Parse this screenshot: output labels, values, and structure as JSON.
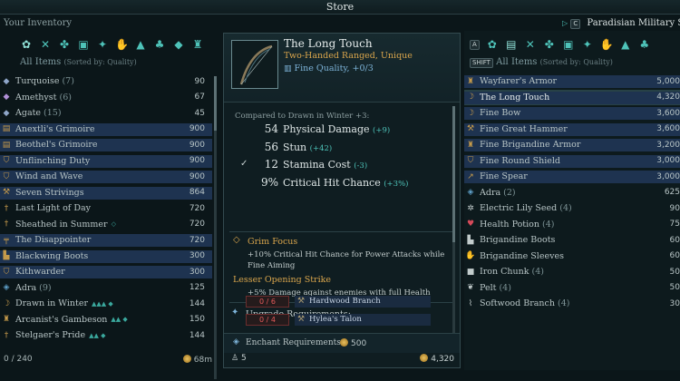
{
  "header": {
    "title": "Store"
  },
  "inventory": {
    "label": "Your Inventory",
    "filter_label": "All Items",
    "sorted_label": "(Sorted by: Quality)",
    "items": [
      {
        "name": "Turquoise",
        "count": "(7)",
        "value": "90",
        "icon": "gem-icon",
        "color": "#8fa6c9",
        "bar": null,
        "pips": ""
      },
      {
        "name": "Amethyst",
        "count": "(6)",
        "value": "67",
        "icon": "gem-icon",
        "color": "#b08fd6",
        "bar": null,
        "pips": ""
      },
      {
        "name": "Agate",
        "count": "(15)",
        "value": "45",
        "icon": "gem-icon",
        "color": "#8fa6c9",
        "bar": null,
        "pips": ""
      },
      {
        "name": "Anextli's Grimoire",
        "count": "",
        "value": "900",
        "icon": "book-icon",
        "color": "#c59a4b",
        "bar": "#1e3350",
        "pips": ""
      },
      {
        "name": "Beothel's Grimoire",
        "count": "",
        "value": "900",
        "icon": "book-icon",
        "color": "#c59a4b",
        "bar": "#1e3350",
        "pips": ""
      },
      {
        "name": "Unflinching Duty",
        "count": "",
        "value": "900",
        "icon": "shield-icon",
        "color": "#c59a4b",
        "bar": "#1e3350",
        "pips": ""
      },
      {
        "name": "Wind and Wave",
        "count": "",
        "value": "900",
        "icon": "shield-icon",
        "color": "#c59a4b",
        "bar": "#1e3350",
        "pips": ""
      },
      {
        "name": "Seven Strivings",
        "count": "",
        "value": "864",
        "icon": "axe-icon",
        "color": "#c59a4b",
        "bar": "#1e3350",
        "pips": ""
      },
      {
        "name": "Last Light of Day",
        "count": "",
        "value": "720",
        "icon": "sword-icon",
        "color": "#c59a4b",
        "bar": null,
        "pips": ""
      },
      {
        "name": "Sheathed in Summer",
        "count": "",
        "value": "720",
        "icon": "sword-icon",
        "color": "#c59a4b",
        "bar": null,
        "pips": "◇"
      },
      {
        "name": "The Disappointer",
        "count": "",
        "value": "720",
        "icon": "gun-icon",
        "color": "#c59a4b",
        "bar": "#1e3350",
        "pips": ""
      },
      {
        "name": "Blackwing Boots",
        "count": "",
        "value": "300",
        "icon": "boots-icon",
        "color": "#c59a4b",
        "bar": "#1e3350",
        "pips": ""
      },
      {
        "name": "Kithwarder",
        "count": "",
        "value": "300",
        "icon": "shield-icon",
        "color": "#c59a4b",
        "bar": "#1e3350",
        "pips": ""
      },
      {
        "name": "Adra",
        "count": "(9)",
        "value": "125",
        "icon": "adra-icon",
        "color": "#5fa0c9",
        "bar": null,
        "pips": ""
      },
      {
        "name": "Drawn in Winter",
        "count": "",
        "value": "144",
        "icon": "bow-icon",
        "color": "#c59a4b",
        "bar": null,
        "pips": "▲▲▲ ◆"
      },
      {
        "name": "Arcanist's Gambeson",
        "count": "",
        "value": "150",
        "icon": "armor-icon",
        "color": "#c59a4b",
        "bar": null,
        "pips": "▲▲ ◆"
      },
      {
        "name": "Stelgaer's Pride",
        "count": "",
        "value": "144",
        "icon": "sword-icon",
        "color": "#c59a4b",
        "bar": null,
        "pips": "▲▲ ◆"
      }
    ],
    "capacity": "0 / 240",
    "gold": "68m"
  },
  "tooltip": {
    "title": "The Long Touch",
    "subtitle": "Two-Handed Ranged, Unique",
    "quality": "Fine Quality, +0/3",
    "compare": "Compared to Drawn in Winter +3:",
    "stats": [
      {
        "value": "54",
        "label": "Physical Damage",
        "diff": "(+9)"
      },
      {
        "value": "56",
        "label": "Stun",
        "diff": "(+42)"
      },
      {
        "value": "12",
        "label": "Stamina Cost",
        "diff": "(-3)"
      },
      {
        "value": "9%",
        "label": "Critical Hit Chance",
        "diff": "(+3%)"
      }
    ],
    "perks": [
      {
        "title": "Grim Focus",
        "text": "+10% Critical Hit Chance for Power Attacks while Fine Aiming"
      },
      {
        "title": "Lesser Opening Strike",
        "text": "+5% Damage against enemies with full Health"
      }
    ],
    "upgrade_title": "Upgrade Requirements:",
    "requirements": [
      {
        "count": "0 / 6",
        "name": "Hardwood Branch"
      },
      {
        "count": "0 / 4",
        "name": "Hylea's Talon"
      }
    ],
    "enchant_label": "Enchant Requirements:",
    "enchant_cost": "500",
    "weight": "5",
    "price": "4,320"
  },
  "store": {
    "vendor": "Paradisian Military Sur",
    "filter_label": "All Items",
    "sorted_label": "(Sorted by: Quality)",
    "shift_key": "SHIFT",
    "key_a": "A",
    "key_c": "C",
    "items": [
      {
        "name": "Wayfarer's Armor",
        "count": "",
        "value": "5,000",
        "icon": "armor-icon",
        "color": "#c59a4b",
        "bar": "#1e3350"
      },
      {
        "name": "The Long Touch",
        "count": "",
        "value": "4,320",
        "icon": "bow-icon",
        "color": "#c59a4b",
        "bar": "#1e3350",
        "selected": true
      },
      {
        "name": "Fine Bow",
        "count": "",
        "value": "3,600",
        "icon": "bow-icon",
        "color": "#c59a4b",
        "bar": "#1e3350"
      },
      {
        "name": "Fine Great Hammer",
        "count": "",
        "value": "3,600",
        "icon": "hammer-icon",
        "color": "#c59a4b",
        "bar": "#1e3350"
      },
      {
        "name": "Fine Brigandine Armor",
        "count": "",
        "value": "3,200",
        "icon": "armor-icon",
        "color": "#c59a4b",
        "bar": "#1e3350"
      },
      {
        "name": "Fine Round Shield",
        "count": "",
        "value": "3,000",
        "icon": "shield-icon",
        "color": "#c59a4b",
        "bar": "#1e3350"
      },
      {
        "name": "Fine Spear",
        "count": "",
        "value": "3,000",
        "icon": "spear-icon",
        "color": "#c59a4b",
        "bar": "#1e3350"
      },
      {
        "name": "Adra",
        "count": "(2)",
        "value": "625",
        "icon": "adra-icon",
        "color": "#5fa0c9",
        "bar": null
      },
      {
        "name": "Electric Lily Seed",
        "count": "(4)",
        "value": "90",
        "icon": "seed-icon",
        "color": "#c2cccc",
        "bar": null
      },
      {
        "name": "Health Potion",
        "count": "(4)",
        "value": "75",
        "icon": "potion-icon",
        "color": "#d64a5a",
        "bar": null
      },
      {
        "name": "Brigandine Boots",
        "count": "",
        "value": "60",
        "icon": "boots-icon",
        "color": "#c2cccc",
        "bar": null
      },
      {
        "name": "Brigandine Sleeves",
        "count": "",
        "value": "60",
        "icon": "gloves-icon",
        "color": "#c2cccc",
        "bar": null
      },
      {
        "name": "Iron Chunk",
        "count": "(4)",
        "value": "50",
        "icon": "ore-icon",
        "color": "#c2cccc",
        "bar": null
      },
      {
        "name": "Pelt",
        "count": "(4)",
        "value": "50",
        "icon": "pelt-icon",
        "color": "#c2cccc",
        "bar": null
      },
      {
        "name": "Softwood Branch",
        "count": "(4)",
        "value": "30",
        "icon": "branch-icon",
        "color": "#c2cccc",
        "bar": null
      }
    ]
  }
}
